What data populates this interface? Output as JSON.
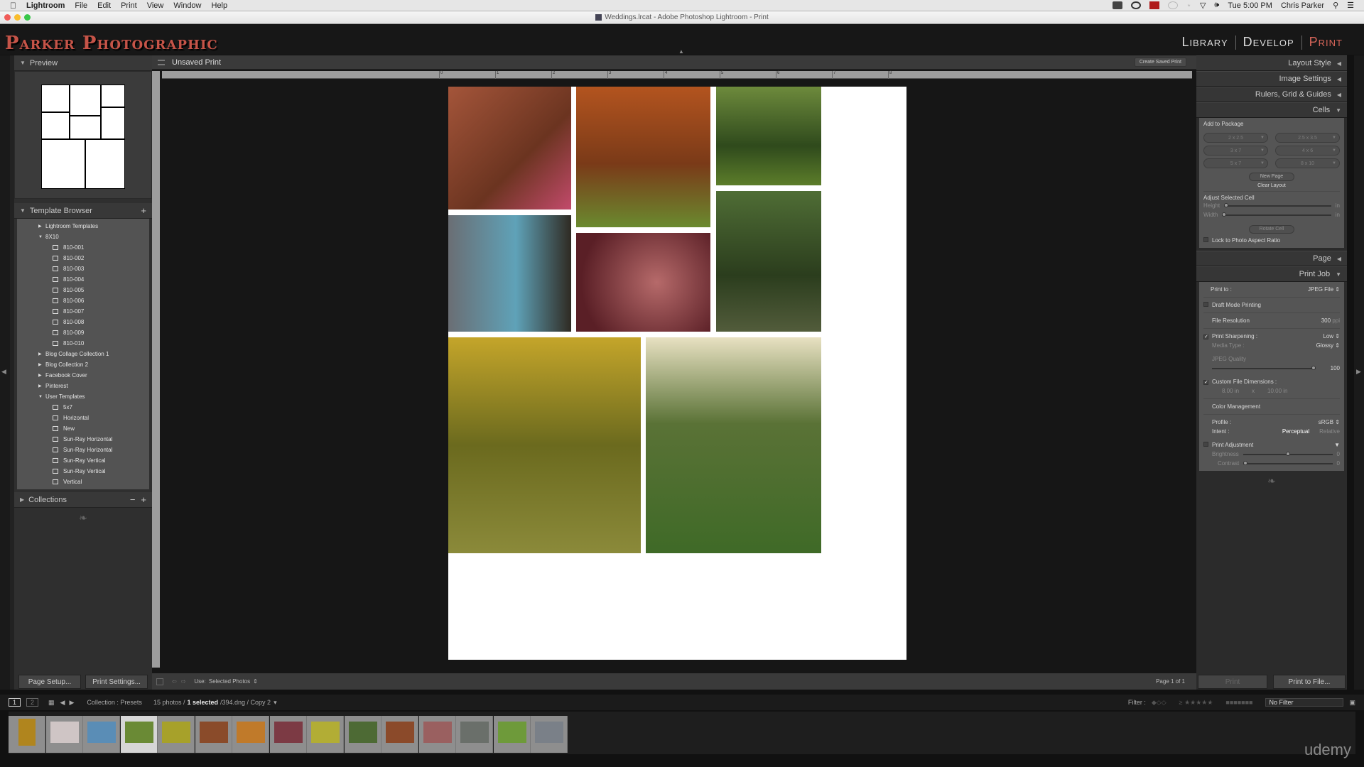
{
  "menubar": {
    "apple": "",
    "app": "Lightroom",
    "menus": [
      "File",
      "Edit",
      "Print",
      "View",
      "Window",
      "Help"
    ],
    "clock": "Tue 5:00 PM",
    "user": "Chris Parker"
  },
  "window": {
    "title": "Weddings.lrcat - Adobe Photoshop Lightroom - Print"
  },
  "identity_plate": "Parker Photographic",
  "modules": [
    {
      "label": "Library",
      "active": false
    },
    {
      "label": "Develop",
      "active": false
    },
    {
      "label": "Print",
      "active": true
    }
  ],
  "accent_color": "#d8665a",
  "left_panel": {
    "preview_title": "Preview",
    "template_browser_title": "Template Browser",
    "templates": [
      {
        "label": "Lightroom Templates",
        "level": 0,
        "type": "folder",
        "expanded": false
      },
      {
        "label": "8X10",
        "level": 0,
        "type": "folder",
        "expanded": true
      },
      {
        "label": "810-001",
        "level": 1,
        "type": "template"
      },
      {
        "label": "810-002",
        "level": 1,
        "type": "template"
      },
      {
        "label": "810-003",
        "level": 1,
        "type": "template"
      },
      {
        "label": "810-004",
        "level": 1,
        "type": "template"
      },
      {
        "label": "810-005",
        "level": 1,
        "type": "template"
      },
      {
        "label": "810-006",
        "level": 1,
        "type": "template"
      },
      {
        "label": "810-007",
        "level": 1,
        "type": "template"
      },
      {
        "label": "810-008",
        "level": 1,
        "type": "template"
      },
      {
        "label": "810-009",
        "level": 1,
        "type": "template"
      },
      {
        "label": "810-010",
        "level": 1,
        "type": "template"
      },
      {
        "label": "Blog Collage Collection 1",
        "level": 0,
        "type": "folder",
        "expanded": false
      },
      {
        "label": "Blog Collection 2",
        "level": 0,
        "type": "folder",
        "expanded": false
      },
      {
        "label": "Facebook Cover",
        "level": 0,
        "type": "folder",
        "expanded": false
      },
      {
        "label": "Pinterest",
        "level": 0,
        "type": "folder",
        "expanded": false
      },
      {
        "label": "User Templates",
        "level": 0,
        "type": "folder",
        "expanded": true
      },
      {
        "label": "5x7",
        "level": 1,
        "type": "template"
      },
      {
        "label": "Horizontal",
        "level": 1,
        "type": "template"
      },
      {
        "label": "New",
        "level": 1,
        "type": "template"
      },
      {
        "label": "Sun-Ray Horizontal",
        "level": 1,
        "type": "template"
      },
      {
        "label": "Sun-Ray Horizontal",
        "level": 1,
        "type": "template"
      },
      {
        "label": "Sun-Ray Vertical",
        "level": 1,
        "type": "template"
      },
      {
        "label": "Sun-Ray Vertical",
        "level": 1,
        "type": "template"
      },
      {
        "label": "Vertical",
        "level": 1,
        "type": "template"
      }
    ],
    "collections_title": "Collections",
    "page_setup": "Page Setup...",
    "print_settings": "Print Settings..."
  },
  "center": {
    "title": "Unsaved Print",
    "create_saved_print": "Create Saved Print",
    "ruler_labels": [
      "0",
      "1",
      "2",
      "3",
      "4",
      "5",
      "6",
      "7",
      "8"
    ],
    "use_label": "Use:",
    "use_value": "Selected Photos",
    "page_indicator": "Page 1 of 1"
  },
  "right_panel": {
    "sections": {
      "layout_style": "Layout Style",
      "image_settings": "Image Settings",
      "rulers": "Rulers, Grid & Guides",
      "cells": "Cells",
      "page": "Page",
      "print_job": "Print Job"
    },
    "cells": {
      "add_to_package": "Add to Package",
      "sizes": [
        "2 x 2.5",
        "2.5 x 3.5",
        "3 x 7",
        "4 x 6",
        "5 x 7",
        "8 x 10"
      ],
      "new_page": "New Page",
      "clear_layout": "Clear Layout",
      "adjust_selected_cell": "Adjust Selected Cell",
      "height_label": "Height",
      "width_label": "Width",
      "unit": "in",
      "rotate_cell": "Rotate Cell",
      "lock_aspect": "Lock to Photo Aspect Ratio"
    },
    "print_job": {
      "print_to_label": "Print to :",
      "print_to_value": "JPEG File",
      "draft_mode": "Draft Mode Printing",
      "file_resolution_label": "File Resolution",
      "file_resolution_value": "300",
      "file_resolution_unit": "ppi",
      "print_sharpening_label": "Print Sharpening :",
      "print_sharpening_value": "Low",
      "media_type_label": "Media Type :",
      "media_type_value": "Glossy",
      "jpeg_quality_label": "JPEG Quality",
      "jpeg_quality_value": "100",
      "custom_dims_label": "Custom File Dimensions :",
      "dim_w": "8.00 in",
      "dim_x": "x",
      "dim_h": "10.00 in",
      "color_management": "Color Management",
      "profile_label": "Profile :",
      "profile_value": "sRGB",
      "intent_label": "Intent :",
      "intent_perceptual": "Perceptual",
      "intent_relative": "Relative",
      "print_adjustment": "Print Adjustment",
      "brightness_label": "Brightness",
      "brightness_value": "0",
      "contrast_label": "Contrast",
      "contrast_value": "0"
    },
    "print_button": "Print",
    "print_to_file_button": "Print to File..."
  },
  "filmstrip": {
    "view1": "1",
    "view2": "2",
    "source": "Collection : Presets",
    "count": "15 photos /",
    "selected": "1 selected",
    "file": "/394.dng / Copy 2",
    "filter_label": "Filter :",
    "filter_value": "No Filter",
    "thumb_count": 15,
    "selected_index": 3
  },
  "watermark": "udemy"
}
